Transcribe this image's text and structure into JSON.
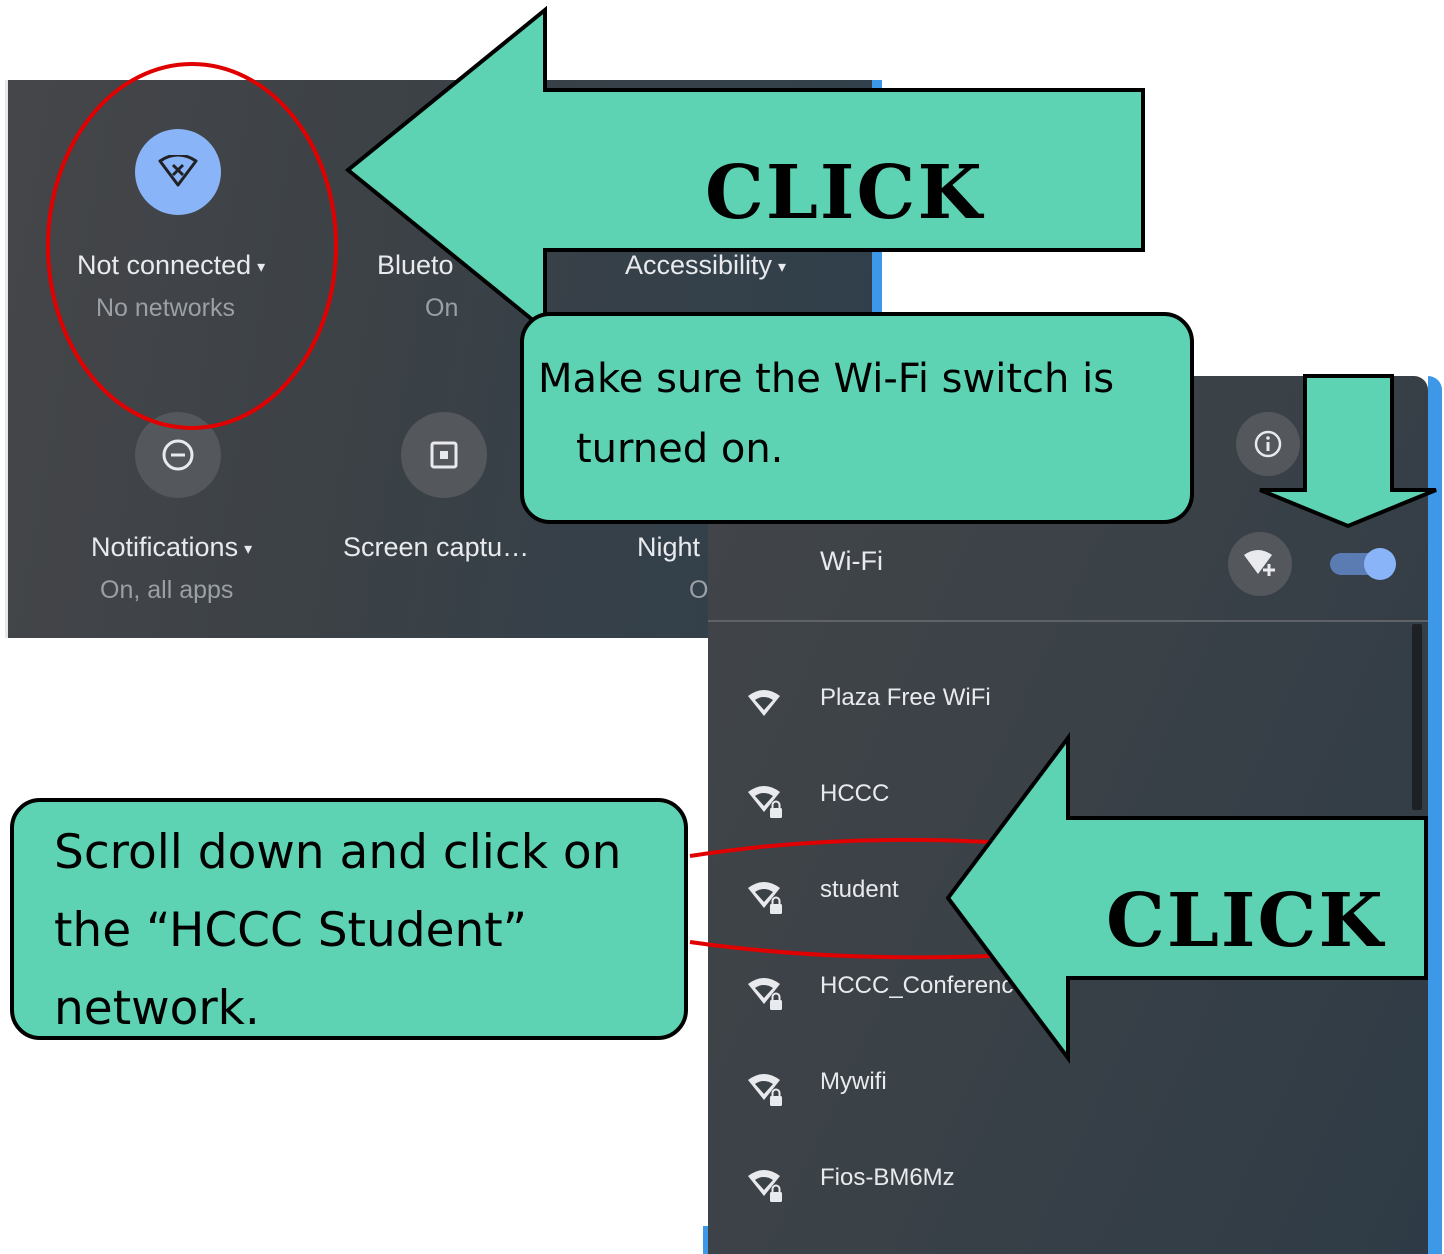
{
  "quick_settings": {
    "tiles": [
      {
        "label": "Not connected",
        "sub": "No networks",
        "icon": "wifi-off-icon",
        "active": true
      },
      {
        "label": "Blueto",
        "sub": "On",
        "icon": "bluetooth-icon"
      },
      {
        "label": "Accessibility",
        "sub": "",
        "icon": "accessibility-icon"
      },
      {
        "label": "Notifications",
        "sub": "On, all apps",
        "icon": "do-not-disturb-icon"
      },
      {
        "label": "Screen captu…",
        "sub": "",
        "icon": "screen-capture-icon"
      },
      {
        "label": "Night",
        "sub": "O",
        "icon": "night-light-icon"
      }
    ],
    "caret": "▾"
  },
  "network_panel": {
    "title": "Wi-Fi",
    "wifi_enabled": true,
    "networks": [
      {
        "name": "Plaza Free WiFi",
        "secured": false
      },
      {
        "name": "HCCC",
        "secured": true
      },
      {
        "name": "student",
        "secured": true
      },
      {
        "name": "HCCC_Conference",
        "secured": true
      },
      {
        "name": "Mywifi",
        "secured": true
      },
      {
        "name": "Fios-BM6Mz",
        "secured": true
      }
    ]
  },
  "annotations": {
    "click_top": "CLICK",
    "click_bottom": "CLICK",
    "callout_top_line1": "Make sure the Wi-Fi switch is",
    "callout_top_line2": "turned on.",
    "callout_bottom_line1": "Scroll down and click on",
    "callout_bottom_line2": "the “HCCC Student”",
    "callout_bottom_line3": "network."
  },
  "colors": {
    "callout_fill": "#5dd3b4",
    "highlight_red": "#e00000",
    "accent_blue": "#8ab4f8"
  }
}
